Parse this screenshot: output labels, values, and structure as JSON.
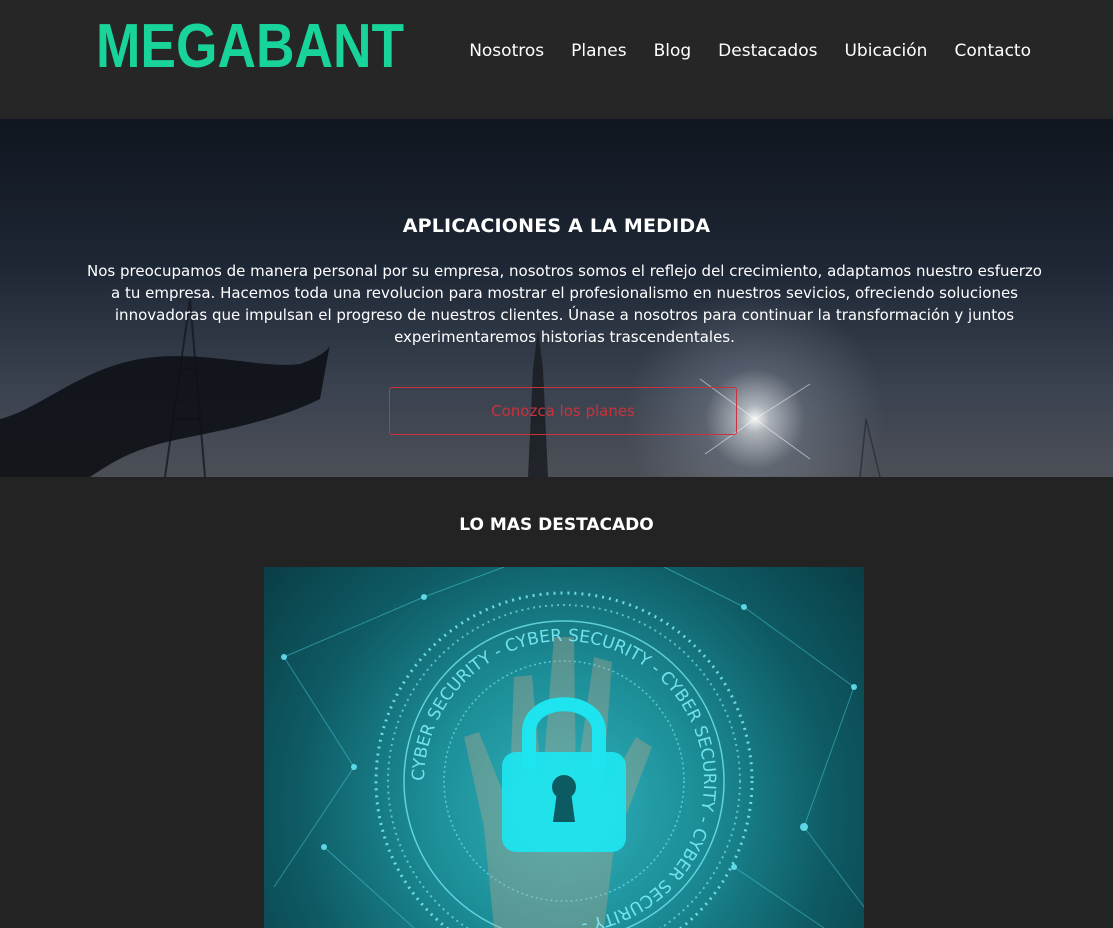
{
  "header": {
    "logo": "MEGABANT",
    "nav": [
      "Nosotros",
      "Planes",
      "Blog",
      "Destacados",
      "Ubicación",
      "Contacto"
    ]
  },
  "hero": {
    "title": "APLICACIONES A LA MEDIDA",
    "text": "Nos preocupamos de manera personal por su empresa, nosotros somos el reflejo del crecimiento, adaptamos nuestro esfuerzo a tu empresa. Hacemos toda una revolucion para mostrar el profesionalismo en nuestros sevicios, ofreciendo soluciones innovadoras que impulsan el progreso de nuestros clientes. Únase a nosotros para continuar la transformación y juntos experimentaremos historias trascendentales.",
    "button": "Conozca los planes"
  },
  "featured": {
    "title": "LO MAS DESTACADO",
    "image_text": "CYBER SECURITY - CYBER SECURITY - CYBER SECURITY - CYBER SECURITY -"
  },
  "colors": {
    "brand": "#19d49a",
    "button_accent": "#c9323c",
    "background": "#232323"
  }
}
